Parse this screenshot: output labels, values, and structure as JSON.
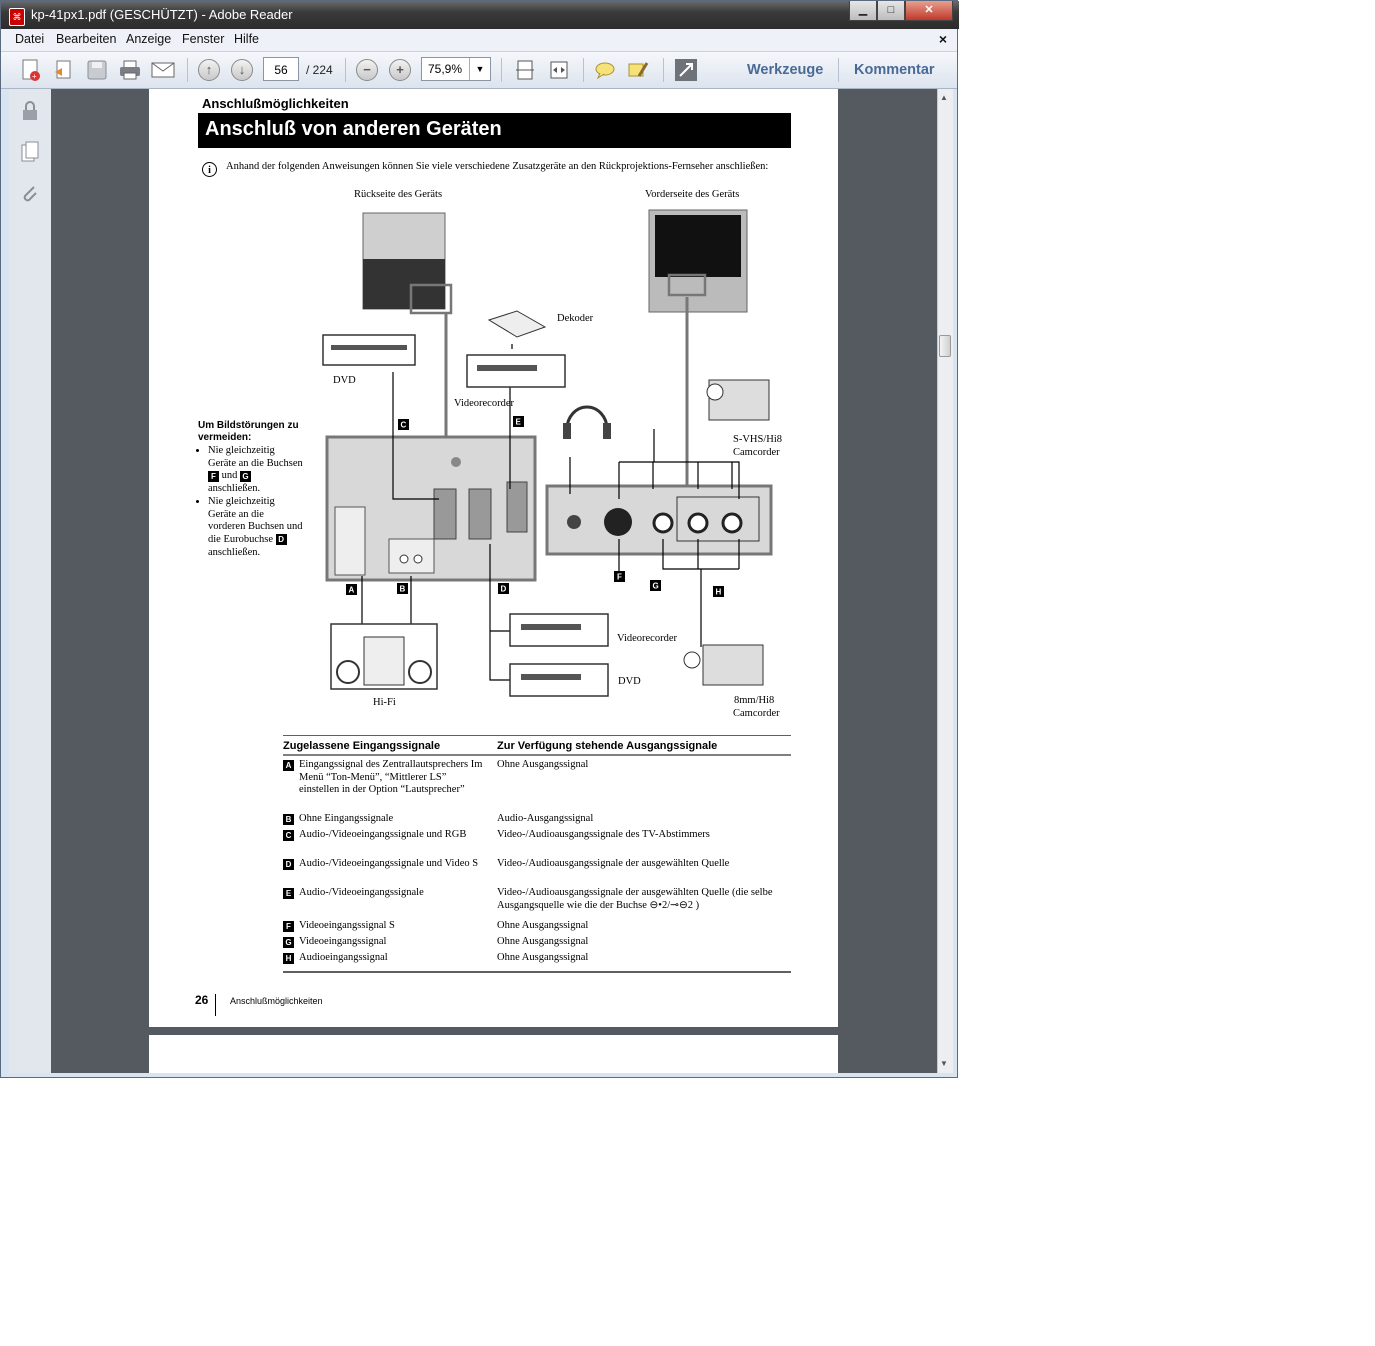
{
  "window": {
    "title": "kp-41px1.pdf (GESCHÜTZT) - Adobe Reader",
    "minimize": "▁",
    "maximize": "□",
    "close": "✕"
  },
  "menu": {
    "items": [
      "Datei",
      "Bearbeiten",
      "Anzeige",
      "Fenster",
      "Hilfe"
    ],
    "close": "×"
  },
  "toolbar": {
    "page_current": "56",
    "page_total": "/ 224",
    "zoom": "75,9%",
    "werkzeuge": "Werkzeuge",
    "kommentar": "Kommentar"
  },
  "document": {
    "section_header": "Anschlußmöglichkeiten",
    "title": "Anschluß von anderen Geräten",
    "intro": "Anhand der folgenden Anweisungen können Sie viele verschiedene Zusatzgeräte an den Rückprojektions-Fernseher anschließen:",
    "diagram": {
      "rear_label": "Rückseite des Geräts",
      "front_label": "Vorderseite des Geräts",
      "dvd_top": "DVD",
      "dekoder": "Dekoder",
      "videorecorder_top": "Videorecorder",
      "svhs": "S-VHS/Hi8",
      "camcorder1": "Camcorder",
      "videorecorder_bottom": "Videorecorder",
      "dvd_bottom": "DVD",
      "hifi": "Hi-Fi",
      "mm8": "8mm/Hi8",
      "camcorder2": "Camcorder",
      "letters": [
        "A",
        "B",
        "C",
        "D",
        "E",
        "F",
        "G",
        "H"
      ]
    },
    "warning": {
      "heading1": "Um Bildstörungen zu",
      "heading2": "vermeiden:",
      "item1a": "Nie gleichzeitig Geräte an die Buchsen",
      "item1b": "und",
      "item1c": "anschließen.",
      "item2a": "Nie gleichzeitig Geräte an die vorderen Buchsen und die Eurobuchse",
      "item2b": "anschließen."
    },
    "table": {
      "col1": "Zugelassene Eingangssignale",
      "col2": "Zur Verfügung stehende Ausgangssignale",
      "rows": [
        {
          "key": "A",
          "input": "Eingangssignal des Zentrallautsprechers Im Menü “Ton-Menü”, “Mittlerer LS” einstellen in der Option “Lautsprecher”",
          "output": "Ohne Ausgangssignal"
        },
        {
          "key": "B",
          "input": "Ohne Eingangssignale",
          "output": "Audio-Ausgangssignal"
        },
        {
          "key": "C",
          "input": "Audio-/Videoeingangssignale und RGB",
          "output": "Video-/Audioausgangssignale des TV-Abstimmers"
        },
        {
          "key": "D",
          "input": "Audio-/Videoeingangssignale und Video S",
          "output": "Video-/Audioausgangssignale der ausgewählten Quelle"
        },
        {
          "key": "E",
          "input": "Audio-/Videoeingangssignale",
          "output": "Video-/Audioausgangssignale der ausgewählten Quelle (die selbe Ausgangsquelle wie die der Buchse ⊖•2/⊸⊖2 )"
        },
        {
          "key": "F",
          "input": "Videoeingangssignal S",
          "output": "Ohne Ausgangssignal"
        },
        {
          "key": "G",
          "input": "Videoeingangssignal",
          "output": "Ohne Ausgangssignal"
        },
        {
          "key": "H",
          "input": "Audioeingangssignal",
          "output": "Ohne Ausgangssignal"
        }
      ]
    },
    "footer": {
      "page_number": "26",
      "text": "Anschlußmöglichkeiten"
    }
  }
}
